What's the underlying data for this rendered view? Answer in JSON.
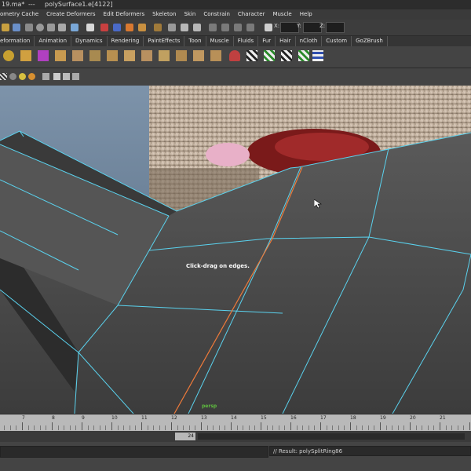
{
  "window": {
    "title_left": "19.ma*",
    "title_sep": "---",
    "title_right": "polySurface1.e[4122]"
  },
  "menu": {
    "items": [
      "ometry Cache",
      "Create Deformers",
      "Edit Deformers",
      "Skeleton",
      "Skin",
      "Constrain",
      "Character",
      "Muscle",
      "Help"
    ]
  },
  "toolbar": {
    "x_label": "X:",
    "y_label": "Y:",
    "z_label": "Z:"
  },
  "shelf_tabs": {
    "items": [
      "eformation",
      "Animation",
      "Dynamics",
      "Rendering",
      "PaintEffects",
      "Toon",
      "Muscle",
      "Fluids",
      "Fur",
      "Hair",
      "nCloth",
      "Custom",
      "GoZBrush"
    ]
  },
  "viewport": {
    "help_line": "Click-drag on edges.",
    "camera": "persp"
  },
  "timeline": {
    "ticks": [
      "7",
      "8",
      "9",
      "10",
      "11",
      "12",
      "13",
      "14",
      "15",
      "16",
      "17",
      "18",
      "19",
      "20",
      "21"
    ]
  },
  "range": {
    "current": "24"
  },
  "command": {
    "result": "// Result: polySplitRing86"
  },
  "colors": {
    "wire": "#5ad2ee",
    "selected_edge": "#ee7a3a",
    "help_text": "#ffffff",
    "camera_label": "#5fbf3f"
  }
}
